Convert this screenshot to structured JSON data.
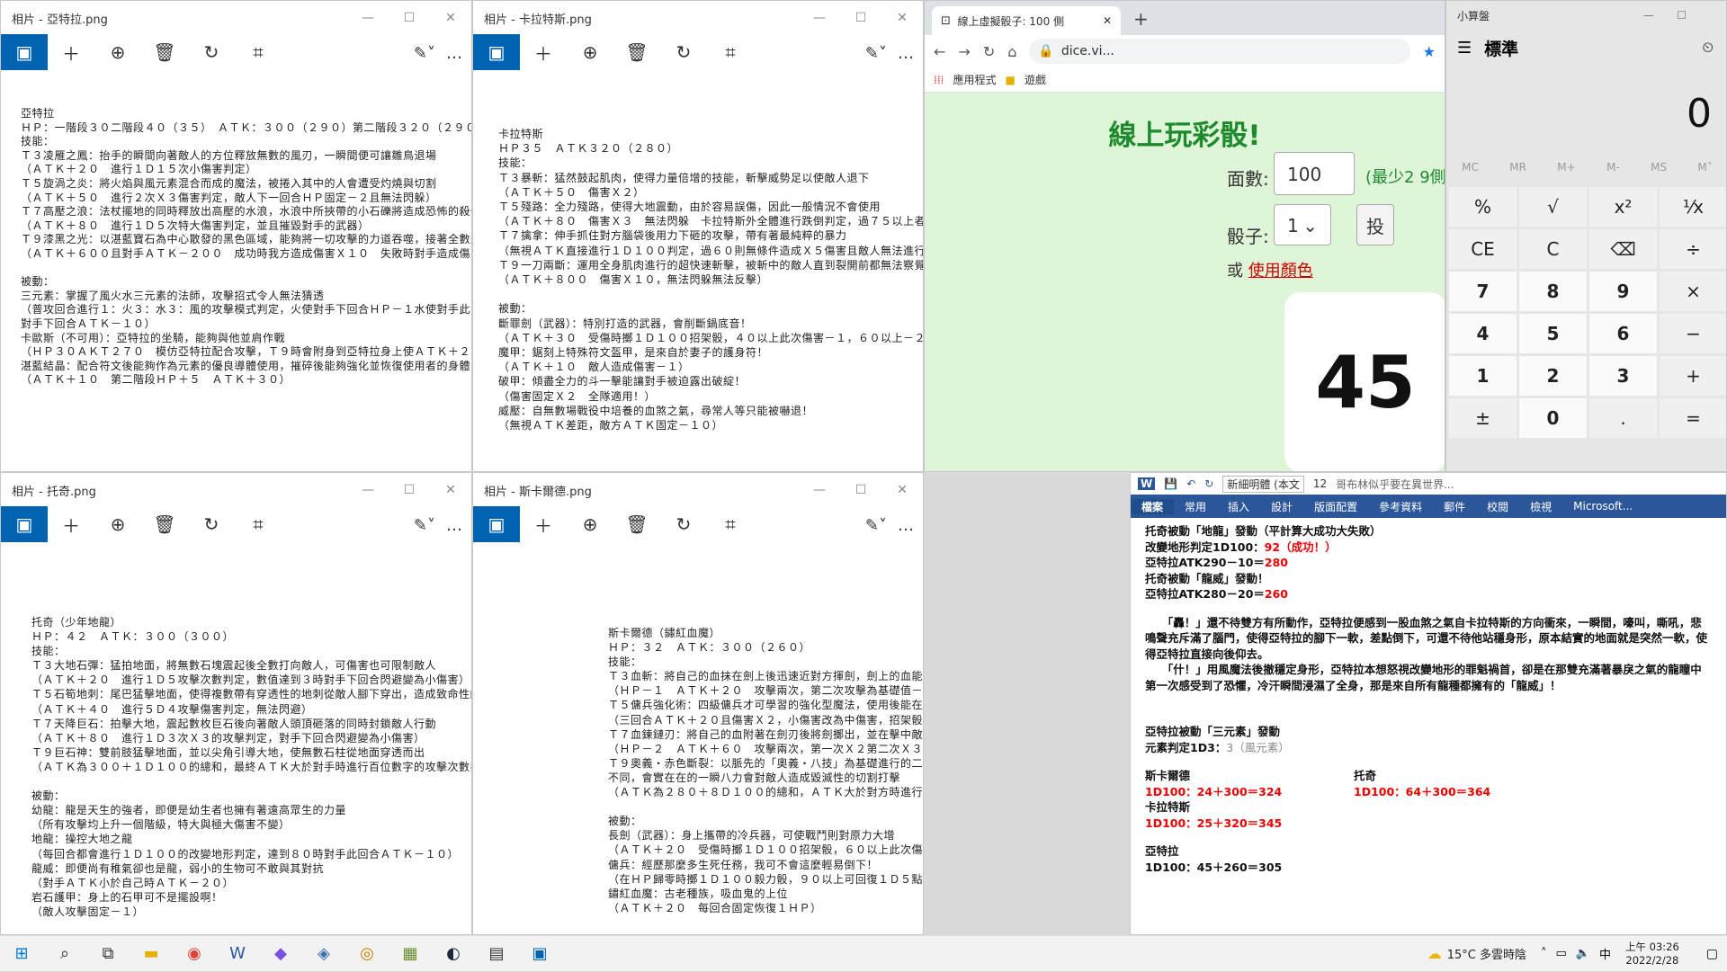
{
  "photo1": {
    "title": "相片 - 亞特拉.png",
    "lines": [
      "亞特拉",
      "ＨＰ：一階段３０二階段４０（３５）　ＡＴＫ：３００（２９０）第二階段３２０（２９０）",
      "技能：",
      "Ｔ３凌雁之鳳：抬手的瞬間向著敵人的方位釋放無數的風刃，一瞬間便可讓雛鳥退場",
      "（ＡＴＫ＋２０　進行１Ｄ１５次小傷害判定）",
      "Ｔ５旋渦之炎：將火焰與風元素混合而成的魔法，被捲入其中的人會遭受灼燒與切割",
      "（ＡＴＫ＋５０　進行２次Ｘ３傷害判定，敵人下一回合ＨＰ固定－２且無法閃躲）",
      "Ｔ７高壓之浪：法杖擺地的同時釋放出高壓的水浪，水浪中所挾帶的小石礫將造成恐怖的殺傷",
      "（ＡＴＫ＋８０　進行１Ｄ５次特大傷害判定，並且摧毀對手的武器）",
      "Ｔ９漆黑之光：以湛藍寶石為中心散發的黑色區域，能夠將一切攻擊的力道吞噬，接著全數返回",
      "（ＡＴＫ＋６００且對手ＡＴＫ－２００　成功時我方造成傷害Ｘ１０　失敗時對手造成傷害Ｘ０.５）",
      "",
      "被動：",
      "三元素：掌握了風火水三元素的法師，攻擊招式令人無法猜透",
      "（普攻回合進行１：火３：水３：風的攻擊模式判定，火使對手下回合ＨＰ－１水使對手此回合傷害－１風使",
      "對手下回合ＡＴＫ－１０）",
      "卡歐斯（不可用）：亞特拉的坐騎，能夠與他並肩作戰",
      "（ＨＰ３０ＡＫＴ２７０　模仿亞特拉配合攻擊，Ｔ９時會附身到亞特拉身上使ＡＴＫ＋２００）",
      "湛藍結晶：配合符文後能夠作為元素的優良導體使用，摧碎後能夠強化並恢復使用者的身體",
      "（ＡＴＫ＋１０　第二階段ＨＰ＋５　ＡＴＫ＋３０）"
    ]
  },
  "photo2": {
    "title": "相片 - 卡拉特斯.png",
    "lines": [
      "卡拉特斯",
      "ＨＰ３５　ＡＴＫ３２０（２８０）",
      "技能：",
      "Ｔ３暴斬：猛然鼓起肌肉，使得力量倍增的技能，斬擊威勢足以使敵人退下",
      "（ＡＴＫ＋５０　傷害Ｘ２）",
      "Ｔ５殘路：全力殘路，使得大地震動，由於容易誤傷，因此一般情況不會使用",
      "（ＡＴＫ＋８０　傷害Ｘ３　無法閃躲　卡拉特斯外全體進行跌倒判定，過７５以上者下回合ＡＴＫ－５０）",
      "Ｔ７擒拿：伸手抓住對方腦袋後用力下砸的攻擊，帶有著最純粹的暴力",
      "（無視ＡＴＫ直接進行１Ｄ１００判定，過６０則無條件造成Ｘ５傷害且敵人無法進行反擊）",
      "Ｔ９一刀兩斷：運用全身肌肉進行的超快速斬擊，被斬中的敵人直到裂開前都無法察覺傷勢",
      "（ＡＴＫ＋８００　傷害Ｘ１０，無法閃躲無法反擊）",
      "",
      "被動：",
      "斷罪劍（武器）：特別打造的武器，會削斷鍋底音！",
      "（ＡＴＫ＋３０　受傷時擲１Ｄ１００招架骰，４０以上此次傷害－１，６０以上－２，８０以上－３）",
      "魔甲：鋸刻上特殊符文盔甲，是來自於妻子的護身符！",
      "（ＡＴＫ＋１０　敵人造成傷害－１）",
      "破甲：傾盡全力的斗一擊能讓對手被迫露出破綻！",
      "（傷害固定Ｘ２　全隊適用！）",
      "威壓：自無數場戰役中培養的血煞之氣，尋常人等只能被嚇退！",
      "（無視ＡＴＫ差距，敵方ＡＴＫ固定－１０）"
    ]
  },
  "photo3": {
    "title": "相片 - 托奇.png",
    "lines": [
      "托奇（少年地龍）",
      "ＨＰ：４２　ＡＴＫ：３００（３００）",
      "技能：",
      "Ｔ３大地石彈：猛拍地面，將無數石塊震起後全數打向敵人，可傷害也可限制敵人",
      "（ＡＴＫ＋２０　進行１Ｄ５攻擊次數判定，數值達到３時對手下回合閃避變為小傷害）",
      "Ｔ５石筍地刺：尾巴猛擊地面，使得複數帶有穿透性的地刺從敵人腳下穿出，造成致命性的打擊",
      "（ＡＴＫ＋４０　進行５Ｄ４攻擊傷害判定，無法閃避）",
      "Ｔ７天降巨石：拍擊大地，震起數枚巨石後向著敵人頭頂砸落的同時封鎖敵人行動",
      "（ＡＴＫ＋８０　進行１Ｄ３次Ｘ３的攻擊判定，對手下回合閃避變為小傷害）",
      "Ｔ９巨石神：雙前肢猛擊地面，並以尖角引導大地，使無數石柱從地面穿透而出",
      "（ＡＴＫ為３００＋１Ｄ１００的總和，最終ＡＴＫ大於對手時進行百位數字的攻擊次數判斷，傷害Ｘ４）",
      "",
      "被動：",
      "幼龍：龍是天生的強者，即便是幼生者也擁有著遠高眾生的力量",
      "（所有攻擊均上升一個階級，特大與極大傷害不變）",
      "地龍：操控大地之龍",
      "（每回合都會進行１Ｄ１００的改變地形判定，達到８０時對手此回合ＡＴＫ－１０）",
      "龍威：即便尚有稚氣卻也是龍，弱小的生物可不敢與其對抗",
      "（對手ＡＴＫ小於自己時ＡＴＫ－２０）",
      "岩石護甲：身上的石甲可不是擺設啊！",
      "（敵人攻擊固定－１）"
    ]
  },
  "photo4": {
    "title": "相片 - 斯卡爾德.png",
    "lines": [
      "斯卡爾德（鏽紅血魔）",
      "ＨＰ：３２　ＡＴＫ：３００（２６０）",
      "技能：",
      "Ｔ３血斬：將自己的血抹在劍上後迅速近對方揮劍，劍上的血能夠造成二次切割傷害",
      "（ＨＰ－１　ＡＴＫ＋２０　攻擊兩次，第二次攻擊為基礎值－１）",
      "Ｔ５傭兵強化術：四級傭兵才可學習的強化型魔法，使用後能在短時間內增強身體素質",
      "（三回合ＡＴＫ＋２０且傷害Ｘ２，小傷害改為中傷害，招架骰改為４０，６０且８０時傷害－３）",
      "Ｔ７血鍊鏈刃：將自己的血附著在劍刃後將劍擲出，並在擊中敵人後猛的拉回，造成二次傷害",
      "（ＨＰ－２　ＡＴＫ＋６０　攻擊兩次，第一次Ｘ２第二次Ｘ３，且第二次攻擊的閃避改為小傷害）",
      "Ｔ９奧義・赤色斷裂：以脈先的「奧義・八技」為基礎進行的二次，在刀刃上抹了自己的血液，與脈先的殘象",
      "不同，會實在在的一瞬八力會對敵人造成毀滅性的切割打擊",
      "（ＡＴＫ為２８０＋８Ｄ１００的總和，ＡＴＫ大於對方時進行８Ｄ５傷害判定　傷害Ｘ３）",
      "",
      "被動：",
      "長劍（武器）：身上攜帶的冷兵器，可使戰鬥則對原力大增",
      "（ＡＴＫ＋２０　受傷時擲１Ｄ１００招架骰，６０以上此次傷害－１，８０以上傷害－２）",
      "傭兵：經歷那麼多生死任務，我可不會這麼輕易倒下！",
      "（在ＨＰ歸零時擲１Ｄ１００毅力骰，９０以上可回復１Ｄ５點ＨＰ）",
      "鏽紅血魔：古老種族，吸血鬼的上位",
      "（ＡＴＫ＋２０　每回合固定恢復１ＨＰ）"
    ]
  },
  "browser": {
    "tab_title": "線上虛擬骰子: 100 側",
    "url": "dice.vi...",
    "bookmark_apps": "應用程式",
    "bookmark_games": "遊戲",
    "heading": "線上玩彩骰!",
    "faces_label": "面數:",
    "faces_value": "100",
    "faces_hint": "(最少2 9側",
    "dice_label": "骰子:",
    "dice_value": "1",
    "roll_button": "投",
    "or_text": "或",
    "color_link": "使用顏色",
    "result": "45"
  },
  "calculator": {
    "title": "小算盤",
    "mode": "標準",
    "display": "0",
    "memory": [
      "MC",
      "MR",
      "M+",
      "M-",
      "MS",
      "M˅"
    ],
    "rows": [
      [
        "%",
        "√",
        "x²",
        "¹⁄x"
      ],
      [
        "CE",
        "C",
        "⌫",
        "÷"
      ],
      [
        "7",
        "8",
        "9",
        "×"
      ],
      [
        "4",
        "5",
        "6",
        "−"
      ],
      [
        "1",
        "2",
        "3",
        "+"
      ],
      [
        "±",
        "0",
        ".",
        "="
      ]
    ]
  },
  "word": {
    "font_name": "新細明體 (本文",
    "font_size": "12",
    "title_hint": "哥布林似乎要在異世界...",
    "tabs": [
      "檔案",
      "常用",
      "插入",
      "設計",
      "版面配置",
      "參考資料",
      "郵件",
      "校閱",
      "檢視",
      "Microsoft..."
    ],
    "line1a": "托奇被動「地龍」發動（平計算大成功大失敗）",
    "line2a": "改變地形判定1D100：",
    "line2b": "92（成功！）",
    "line3a": "亞特拉ATK290－10＝",
    "line3b": "280",
    "line4": "托奇被動「龍威」發動！",
    "line5a": "亞特拉ATK280－20＝",
    "line5b": "260",
    "para1": "　　「轟！」還不待雙方有所動作，亞特拉便感到一股血煞之氣自卡拉特斯的方向衝來，一瞬間，嚎叫，嘶吼，悲鳴聲充斥滿了腦門，使得亞特拉的腳下一軟，差點倒下，可還不待他站穩身形，原本結實的地面就是突然一軟，使得亞特拉直接向後仰去。",
    "para2": "　　「什！」用風魔法後撤穩定身形，亞特拉本想怒視改變地形的罪魁禍首，卻是在那雙充滿著暴戾之氣的龍瞳中第一次感受到了恐懼，冷汗瞬間浸濕了全身，那是來自所有龍種都擁有的「龍威」！",
    "line6": "亞特拉被動「三元素」發動",
    "line7a": "元素判定1D3：",
    "line7b": "3（風元素）",
    "name_skaldr": "斯卡爾德",
    "name_toqi": "托奇",
    "roll_skaldr": "1D100：24＋300＝324",
    "roll_toqi": "1D100：64＋300＝364",
    "name_karats": "卡拉特斯",
    "roll_karats": "1D100：25＋320＝345",
    "name_atla": "亞特拉",
    "roll_atla": "1D100：45＋260＝305"
  },
  "taskbar": {
    "weather": "15°C  多雲時陰",
    "ime": "中",
    "time": "上午 03:26",
    "date": "2022/2/28"
  }
}
